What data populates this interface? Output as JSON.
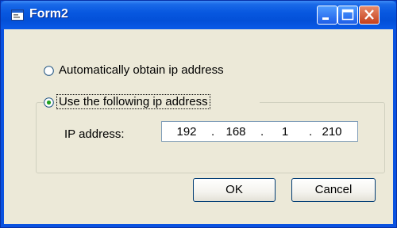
{
  "window": {
    "title": "Form2",
    "icon": "form-app-icon",
    "controls": [
      "minimize-icon",
      "maximize-icon",
      "close-icon"
    ]
  },
  "options": {
    "auto": {
      "label": "Automatically obtain ip address",
      "selected": false
    },
    "manual": {
      "label": "Use the following ip address",
      "selected": true
    }
  },
  "ip": {
    "label": "IP address:",
    "octets": [
      "192",
      "168",
      "1",
      "210"
    ],
    "separator": "."
  },
  "buttons": {
    "ok": "OK",
    "cancel": "Cancel"
  },
  "colors": {
    "titlebar": "#0858e0",
    "client": "#ece9d8",
    "close": "#c4401c"
  }
}
